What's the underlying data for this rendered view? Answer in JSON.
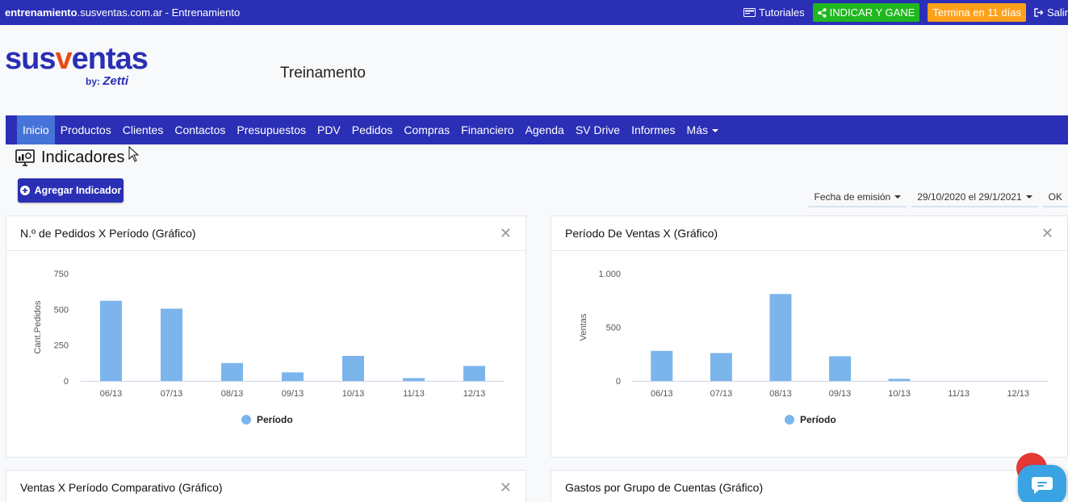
{
  "topbar": {
    "site_domain": "entrenamiento",
    "site_rest": ".susventas.com.ar",
    "site_suffix": " - Entrenamiento",
    "tutoriales": "Tutoriales",
    "indicar": "INDICAR Y GANE",
    "trial": "Termina en 11 días",
    "salir": "Salir"
  },
  "brand": {
    "logo_text_a": "sus",
    "logo_text_v": "v",
    "logo_text_b": "entas",
    "by": "by:",
    "by_name": "Zetti"
  },
  "header": {
    "title": "Treinamento"
  },
  "nav": {
    "items": [
      "Inicio",
      "Productos",
      "Clientes",
      "Contactos",
      "Presupuestos",
      "PDV",
      "Pedidos",
      "Compras",
      "Financiero",
      "Agenda",
      "SV Drive",
      "Informes",
      "Más"
    ]
  },
  "page": {
    "title": "Indicadores",
    "add_button": "Agregar Indicador"
  },
  "filters": {
    "date_type": "Fecha de emisión",
    "range": "29/10/2020 el 29/1/2021",
    "ok": "OK"
  },
  "cards": [
    {
      "title": "N.º de Pedidos X Período (Gráfico)"
    },
    {
      "title": "Período De Ventas X (Gráfico)"
    },
    {
      "title": "Ventas X Período Comparativo (Gráfico)"
    },
    {
      "title": "Gastos por Grupo de Cuentas (Gráfico)"
    }
  ],
  "colors": {
    "primary": "#2a2fb5",
    "bar": "#7cb5ec",
    "green": "#1fb81f",
    "orange": "#ffa01a"
  },
  "chart_data": [
    {
      "type": "bar",
      "categories": [
        "06/13",
        "07/13",
        "08/13",
        "09/13",
        "10/13",
        "11/13",
        "12/13"
      ],
      "values": [
        560,
        505,
        125,
        60,
        175,
        20,
        105
      ],
      "ylabel": "Cant.Pedidos",
      "yticks": [
        "0",
        "250",
        "500",
        "750"
      ],
      "ylim": [
        0,
        750
      ],
      "series": [
        {
          "name": "Período",
          "values": [
            560,
            505,
            125,
            60,
            175,
            20,
            105
          ]
        }
      ]
    },
    {
      "type": "bar",
      "categories": [
        "06/13",
        "07/13",
        "08/13",
        "09/13",
        "10/13",
        "11/13",
        "12/13"
      ],
      "values": [
        280,
        260,
        810,
        230,
        20,
        0,
        0
      ],
      "ylabel": "Ventas",
      "yticks": [
        "0",
        "500",
        "1.000"
      ],
      "ylim": [
        0,
        1000
      ],
      "series": [
        {
          "name": "Período",
          "values": [
            280,
            260,
            810,
            230,
            20,
            0,
            0
          ]
        }
      ]
    }
  ]
}
